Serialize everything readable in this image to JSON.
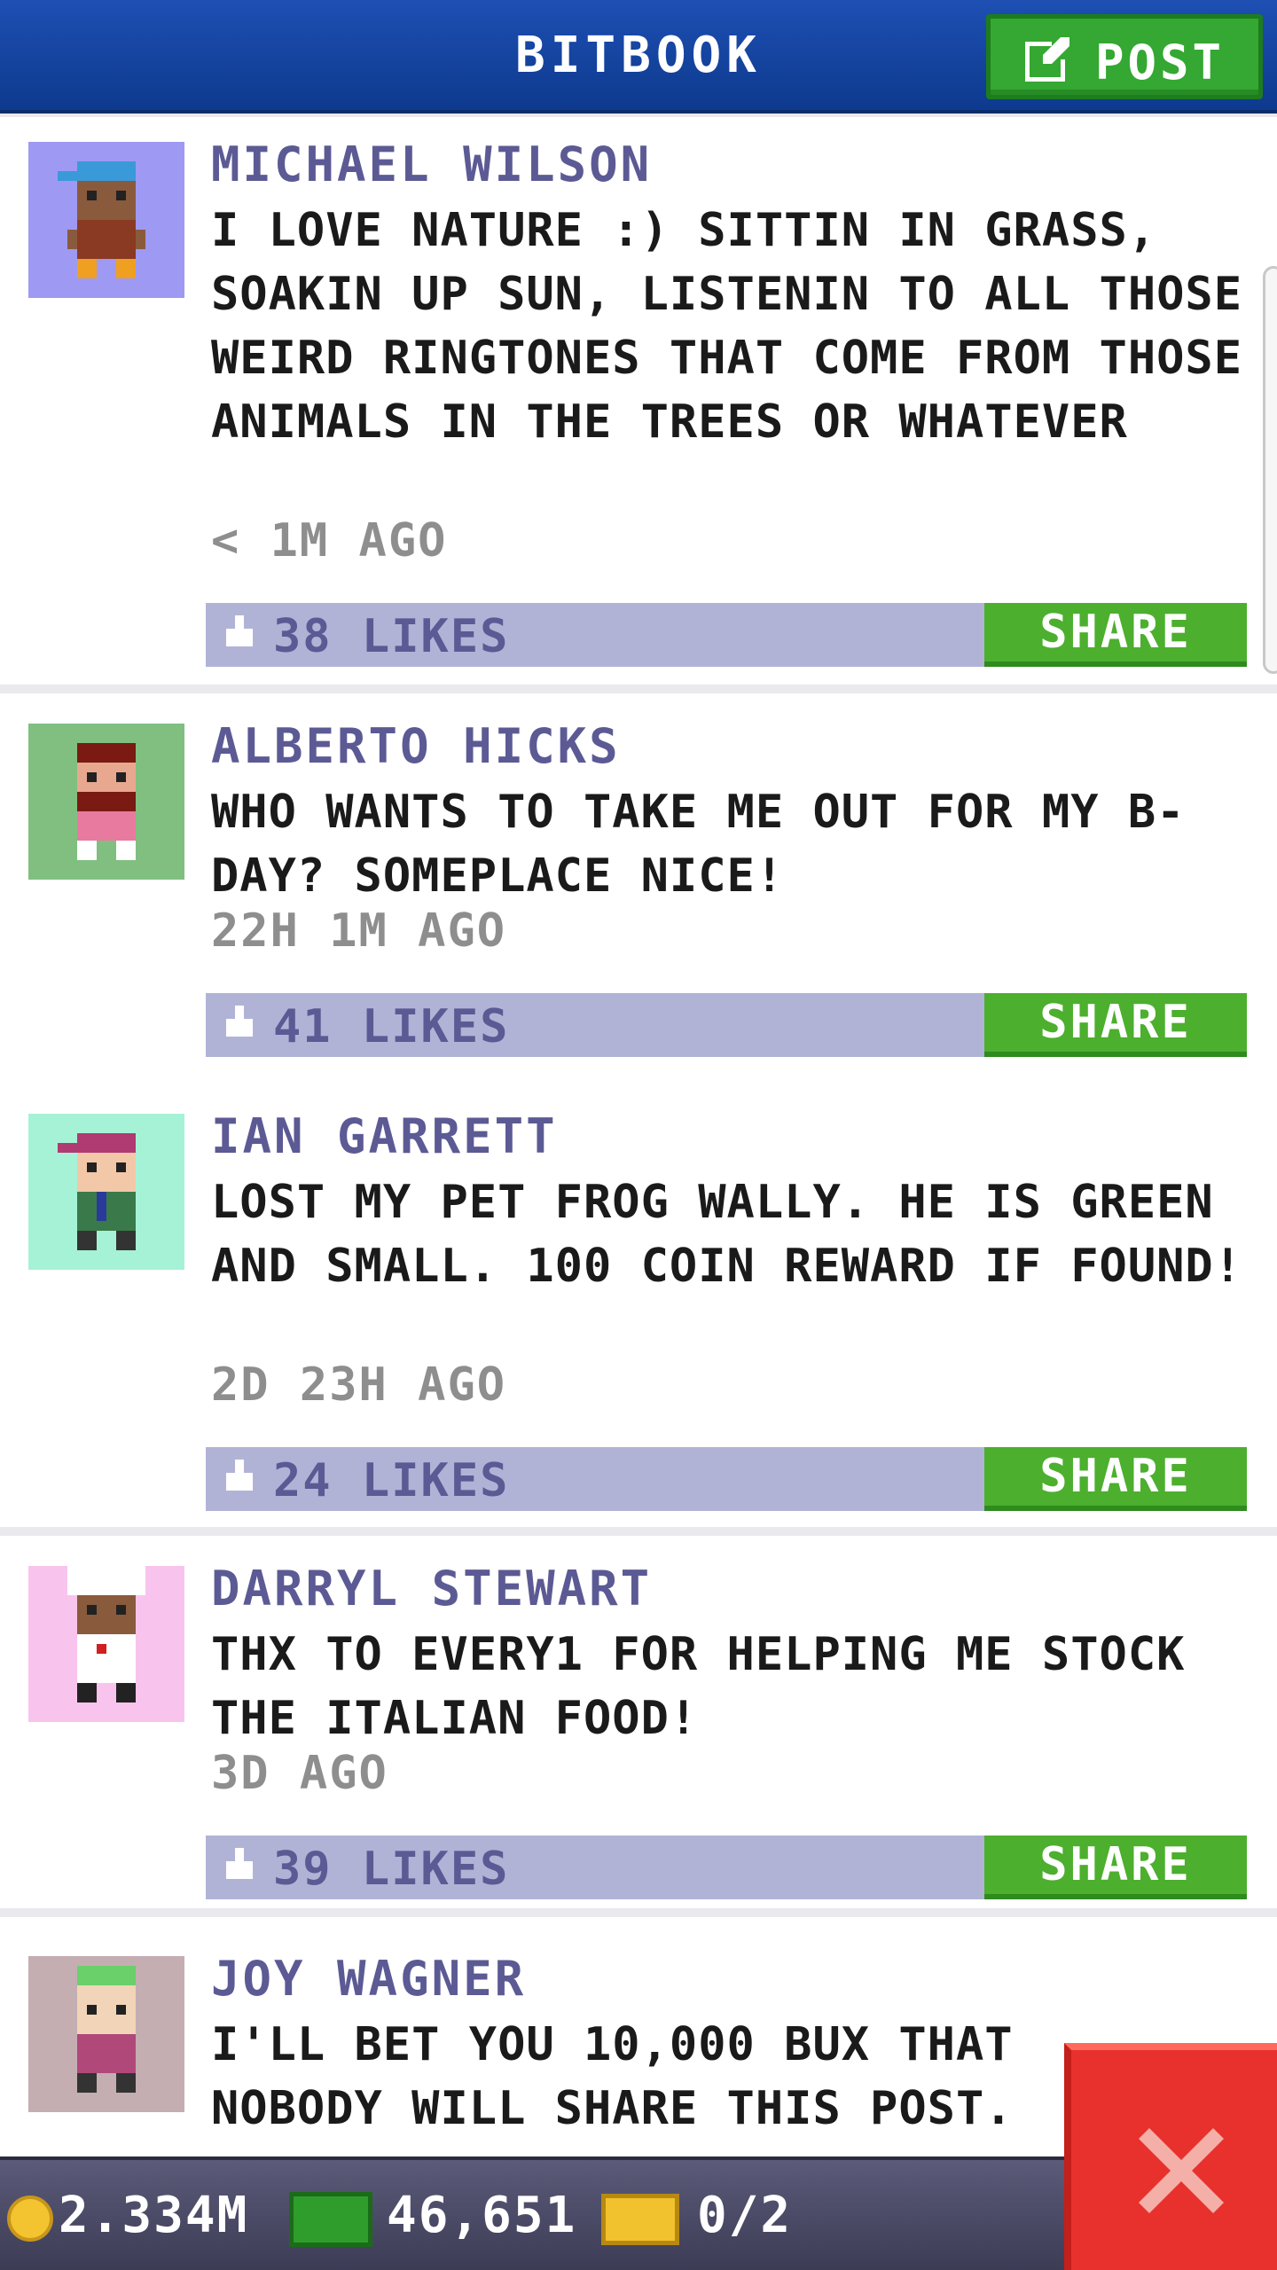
{
  "header": {
    "title": "BITBOOK",
    "post_label": "POST"
  },
  "colors": {
    "header_blue": "#1e4fb3",
    "post_green": "#34a832",
    "author_purple": "#5c5a94",
    "like_bar": "#b1b3d6",
    "share_green": "#4caf2e",
    "close_red": "#e8312c"
  },
  "posts": [
    {
      "author": "MICHAEL WILSON",
      "avatar_bg": "#9e99f2",
      "text": "I LOVE NATURE :) SITTIN IN GRASS, SOAKIN UP SUN, LISTENIN TO ALL THOSE WEIRD RINGTONES THAT COME FROM THOSE ANIMALS IN THE TREES OR WHATEVER",
      "time": "< 1M AGO",
      "likes": "38 LIKES",
      "share": "SHARE"
    },
    {
      "author": "ALBERTO HICKS",
      "avatar_bg": "#80bf80",
      "text": "WHO WANTS TO TAKE ME OUT FOR MY B-DAY? SOMEPLACE NICE!",
      "time": "22H 1M AGO",
      "likes": "41 LIKES",
      "share": "SHARE"
    },
    {
      "author": "IAN GARRETT",
      "avatar_bg": "#a6f2d6",
      "text": "LOST MY PET FROG WALLY. HE IS GREEN AND SMALL. 100 COIN REWARD IF FOUND!",
      "time": "2D 23H AGO",
      "likes": "24 LIKES",
      "share": "SHARE"
    },
    {
      "author": "DARRYL STEWART",
      "avatar_bg": "#f8c4ee",
      "text": "THX TO EVERY1 FOR HELPING ME STOCK THE ITALIAN FOOD!",
      "time": "3D AGO",
      "likes": "39 LIKES",
      "share": "SHARE"
    },
    {
      "author": "JOY WAGNER",
      "avatar_bg": "#c4aeb2",
      "text": "I'LL BET YOU 10,000 BUX THAT NOBODY WILL SHARE THIS POST."
    }
  ],
  "footer": {
    "coins": "2.334M",
    "bux": "46,651",
    "tickets": "0/2"
  }
}
